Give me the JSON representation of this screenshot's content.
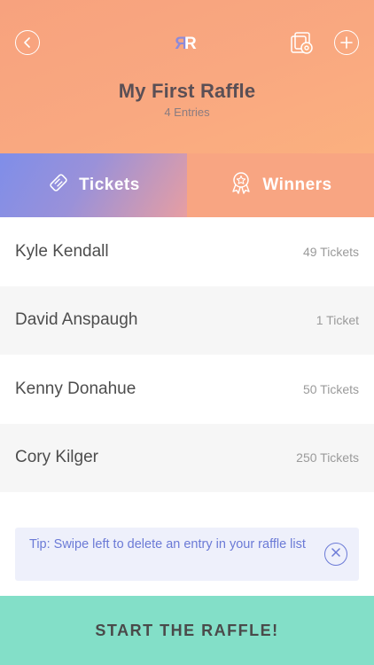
{
  "header": {
    "logo_text": "RR",
    "title": "My First Raffle",
    "subtitle": "4 Entries"
  },
  "icons": {
    "back": "chevron-left-icon",
    "settings": "gear-icon",
    "add": "plus-icon",
    "tickets": "ticket-icon",
    "winners": "award-icon",
    "close": "close-icon"
  },
  "tabs": [
    {
      "label": "Tickets",
      "active": true
    },
    {
      "label": "Winners",
      "active": false
    }
  ],
  "entries": [
    {
      "name": "Kyle Kendall",
      "tickets": "49 Tickets"
    },
    {
      "name": "David Anspaugh",
      "tickets": "1 Ticket"
    },
    {
      "name": "Kenny Donahue",
      "tickets": "50 Tickets"
    },
    {
      "name": "Cory Kilger",
      "tickets": "250 Tickets"
    }
  ],
  "tip": {
    "text": "Tip: Swipe left to delete an entry in your raffle list"
  },
  "cta": {
    "label": "START THE RAFFLE!"
  },
  "colors": {
    "header": "#f9a880",
    "tickets_tab": "#7f8ee9",
    "cta": "#83dfc8",
    "tip_bg": "#eef0fb",
    "tip_text": "#6b7ad6"
  }
}
